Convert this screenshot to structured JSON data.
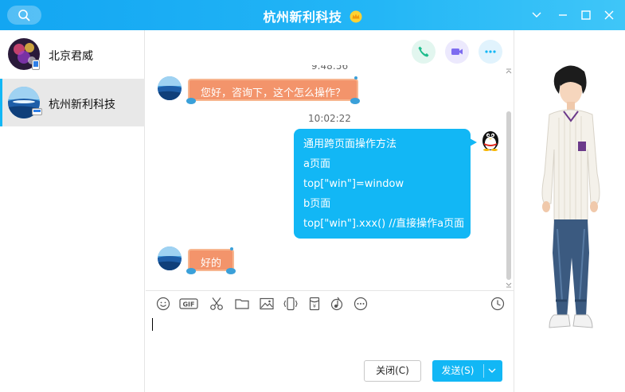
{
  "window": {
    "title": "杭州新利科技",
    "accent": "#12b7f5"
  },
  "icons": {
    "search": "search-icon",
    "vip": "vip-crown-icon",
    "minimize_dropdown": "chevron-down-icon",
    "minimize": "minimize-icon",
    "maximize": "maximize-icon",
    "close": "close-icon"
  },
  "contacts": [
    {
      "name": "北京君威",
      "active": false
    },
    {
      "name": "杭州新利科技",
      "active": true
    }
  ],
  "chat_actions": [
    "phone-call",
    "video-call",
    "more"
  ],
  "messages": {
    "partial_timestamp": "9:48:56",
    "first": {
      "text": "您好，咨询下，这个怎么操作？",
      "from": "other"
    },
    "timestamp": "10:02:22",
    "reply": {
      "from": "me",
      "lines": [
        "通用跨页面操作方法",
        "a页面",
        "top[\"win\"]=window",
        "b页面",
        "top[\"win\"].xxx()  //直接操作a页面"
      ]
    },
    "last": {
      "text": "好的",
      "from": "other"
    }
  },
  "toolbar": [
    "emoji",
    "gif",
    "screenshot",
    "folder",
    "image",
    "shake",
    "red-packet",
    "music",
    "more",
    "history"
  ],
  "buttons": {
    "close": "关闭(C)",
    "send": "发送(S)"
  },
  "colors": {
    "titlebar": "#13a6f2",
    "bubble_me": "#12b7f5",
    "bubble_other": "#f3946b",
    "call_phone": "#1dbc8c",
    "call_video": "#7d6cf0"
  }
}
